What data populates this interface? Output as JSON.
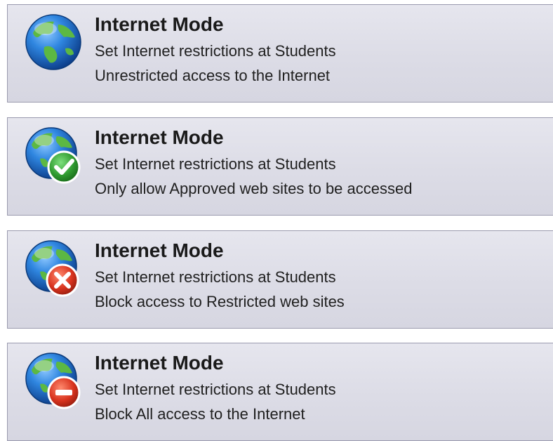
{
  "modes": [
    {
      "title": "Internet Mode",
      "subtitle": "Set Internet restrictions at Students",
      "description": "Unrestricted access to the Internet",
      "icon": "globe-icon"
    },
    {
      "title": "Internet Mode",
      "subtitle": "Set Internet restrictions at Students",
      "description": "Only allow Approved web sites to be accessed",
      "icon": "globe-check-icon"
    },
    {
      "title": "Internet Mode",
      "subtitle": "Set Internet restrictions at Students",
      "description": "Block access to Restricted web sites",
      "icon": "globe-x-icon"
    },
    {
      "title": "Internet Mode",
      "subtitle": "Set Internet restrictions at Students",
      "description": "Block All access to the Internet",
      "icon": "globe-block-icon"
    }
  ],
  "colors": {
    "globe_ocean": "#1f6fc9",
    "globe_land": "#4fa83a",
    "check_badge": "#2f9a2f",
    "x_badge": "#d8331e",
    "block_badge": "#d8331e"
  }
}
